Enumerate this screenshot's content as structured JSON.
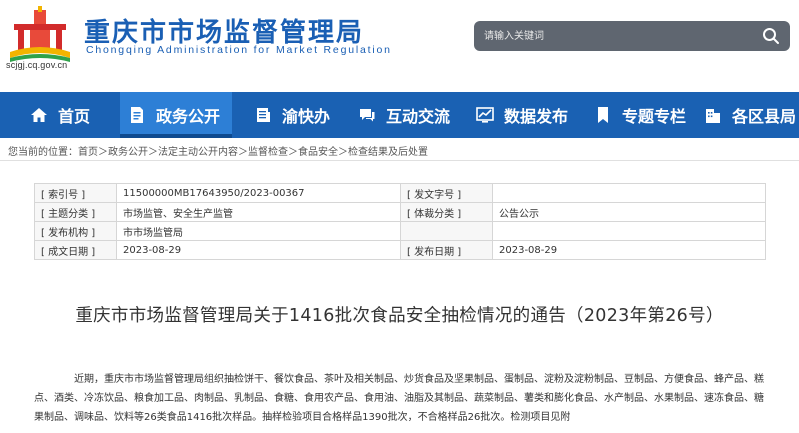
{
  "header": {
    "title": "重庆市市场监督管理局",
    "subtitle": "Chongqing  Administration for Market Regulation",
    "domain": "scjgj.cq.gov.cn",
    "search_placeholder": "请输入关键词",
    "brand_color": "#1a5fb4"
  },
  "nav": {
    "items": [
      {
        "label": "首页",
        "icon": "home-icon"
      },
      {
        "label": "政务公开",
        "icon": "document-icon",
        "active": true
      },
      {
        "label": "渝快办",
        "icon": "clipboard-icon"
      },
      {
        "label": "互动交流",
        "icon": "chat-icon"
      },
      {
        "label": "数据发布",
        "icon": "chart-icon"
      },
      {
        "label": "专题专栏",
        "icon": "bookmark-icon"
      },
      {
        "label": "各区县局",
        "icon": "building-icon"
      }
    ]
  },
  "breadcrumb": {
    "prefix": "您当前的位置：",
    "items": [
      "首页",
      "政务公开",
      "法定主动公开内容",
      "监督检查",
      "食品安全",
      "检查结果及后处置"
    ]
  },
  "info": {
    "rows": [
      {
        "l1": "[ 索引号 ]",
        "v1": "11500000MB17643950/2023-00367",
        "l2": "[ 发文字号 ]",
        "v2": ""
      },
      {
        "l1": "[ 主题分类 ]",
        "v1": "市场监管、安全生产监管",
        "l2": "[ 体裁分类 ]",
        "v2": "公告公示"
      },
      {
        "l1": "[ 发布机构 ]",
        "v1": "市市场监管局",
        "l2": "",
        "v2": ""
      },
      {
        "l1": "[ 成文日期 ]",
        "v1": "2023-08-29",
        "l2": "[ 发布日期 ]",
        "v2": "2023-08-29"
      }
    ]
  },
  "article": {
    "title": "重庆市市场监督管理局关于1416批次食品安全抽检情况的通告（2023年第26号）",
    "body": "近期，重庆市市场监督管理局组织抽检饼干、餐饮食品、茶叶及相关制品、炒货食品及坚果制品、蛋制品、淀粉及淀粉制品、豆制品、方便食品、蜂产品、糕点、酒类、冷冻饮品、粮食加工品、肉制品、乳制品、食糖、食用农产品、食用油、油脂及其制品、蔬菜制品、薯类和膨化食品、水产制品、水果制品、速冻食品、糖果制品、调味品、饮料等26类食品1416批次样品。抽样检验项目合格样品1390批次，不合格样品26批次。检测项目见附"
  }
}
